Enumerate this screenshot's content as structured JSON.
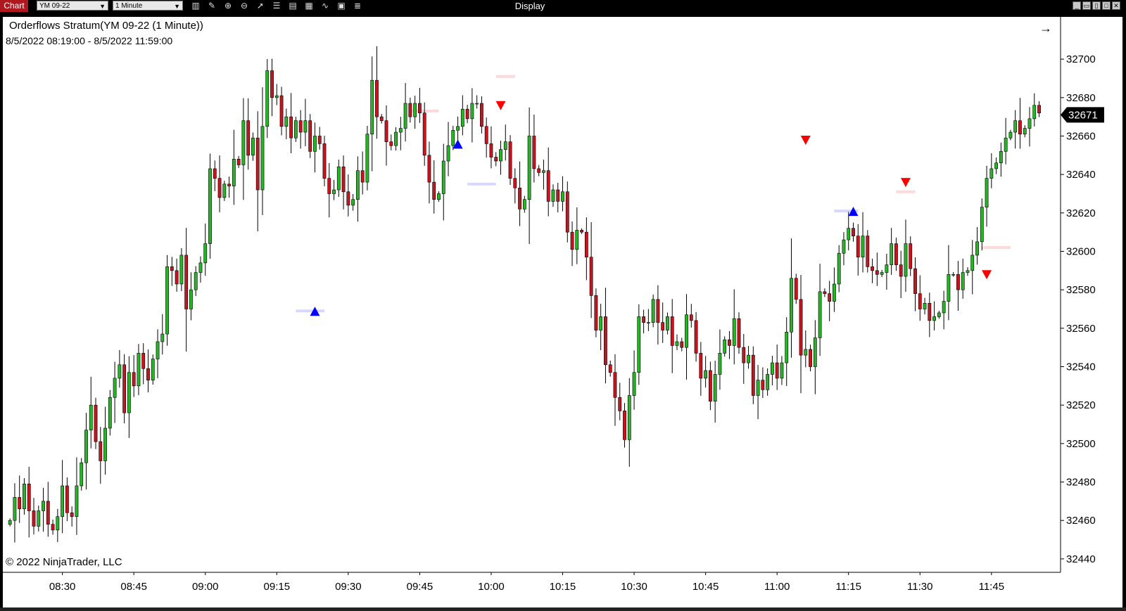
{
  "toolbar": {
    "app_label": "Chart",
    "instrument": "YM 09-22",
    "period": "1 Minute",
    "window_title": "Display",
    "tools": [
      "bar-style-icon",
      "pencil-icon",
      "zoom-in-icon",
      "zoom-out-icon",
      "pointer-icon",
      "properties-icon",
      "data-box-icon",
      "indicators-icon",
      "strategies-icon",
      "templates-icon",
      "menu-icon"
    ]
  },
  "chart": {
    "indicator_title": "Orderflows Stratum(YM 09-22 (1 Minute))",
    "date_range": "8/5/2022 08:19:00 - 8/5/2022 11:59:00",
    "copyright": "© 2022 NinjaTrader, LLC",
    "last_price": "32671",
    "colors": {
      "up": "#27b427",
      "down": "#c8141e",
      "signal_up": "#0000ff",
      "signal_down": "#ff0000",
      "price_marker": "#000000"
    }
  },
  "chart_data": {
    "type": "candlestick",
    "y_ticks": [
      32440,
      32460,
      32480,
      32500,
      32520,
      32540,
      32560,
      32580,
      32600,
      32620,
      32640,
      32660,
      32680,
      32700
    ],
    "x_ticks": [
      {
        "label": "08:30",
        "minute": 11
      },
      {
        "label": "08:45",
        "minute": 26
      },
      {
        "label": "09:00",
        "minute": 41
      },
      {
        "label": "09:15",
        "minute": 56
      },
      {
        "label": "09:30",
        "minute": 71
      },
      {
        "label": "09:45",
        "minute": 86
      },
      {
        "label": "10:00",
        "minute": 101
      },
      {
        "label": "10:15",
        "minute": 116
      },
      {
        "label": "10:30",
        "minute": 131
      },
      {
        "label": "10:45",
        "minute": 146
      },
      {
        "label": "11:00",
        "minute": 161
      },
      {
        "label": "11:15",
        "minute": 176
      },
      {
        "label": "11:30",
        "minute": 191
      },
      {
        "label": "11:45",
        "minute": 206
      }
    ],
    "ylim": [
      32433,
      32722
    ],
    "x_range": [
      -1.5,
      220.5
    ],
    "closes": [
      32460,
      32472,
      32466,
      32479,
      32465,
      32457,
      32465,
      32470,
      32458,
      32455,
      32462,
      32478,
      32464,
      32462,
      32478,
      32490,
      32507,
      32520,
      32501,
      32491,
      32508,
      32524,
      32534,
      32541,
      32516,
      32537,
      32530,
      32547,
      32539,
      32533,
      32544,
      32553,
      32557,
      32592,
      32590,
      32583,
      32598,
      32570,
      32580,
      32589,
      32594,
      32604,
      32643,
      32638,
      32628,
      32635,
      32634,
      32648,
      32645,
      32668,
      32650,
      32659,
      32632,
      32665,
      32694,
      32680,
      32681,
      32665,
      32670,
      32659,
      32668,
      32662,
      32668,
      32652,
      32660,
      32656,
      32638,
      32630,
      32632,
      32644,
      32631,
      32624,
      32627,
      32642,
      32636,
      32661,
      32689,
      32670,
      32668,
      32657,
      32655,
      32662,
      32664,
      32677,
      32670,
      32677,
      32672,
      32650,
      32636,
      32627,
      32630,
      32647,
      32655,
      32663,
      32665,
      32674,
      32669,
      32677,
      32677,
      32665,
      32656,
      32649,
      32647,
      32653,
      32657,
      32638,
      32633,
      32622,
      32627,
      32660,
      32643,
      32641,
      32642,
      32626,
      32632,
      32626,
      32631,
      32610,
      32601,
      32611,
      32610,
      32597,
      32577,
      32559,
      32566,
      32541,
      32537,
      32524,
      32517,
      32502,
      32525,
      32537,
      32566,
      32563,
      32563,
      32575,
      32563,
      32559,
      32566,
      32551,
      32553,
      32550,
      32567,
      32564,
      32547,
      32534,
      32538,
      32522,
      32536,
      32547,
      32554,
      32551,
      32565,
      32550,
      32542,
      32546,
      32525,
      32533,
      32528,
      32536,
      32542,
      32534,
      32542,
      32558,
      32586,
      32575,
      32546,
      32549,
      32540,
      32555,
      32579,
      32578,
      32574,
      32583,
      32599,
      32606,
      32612,
      32608,
      32597,
      32608,
      32592,
      32590,
      32588,
      32589,
      32593,
      32604,
      32593,
      32587,
      32604,
      32591,
      32578,
      32570,
      32573,
      32564,
      32566,
      32568,
      32574,
      32588,
      32588,
      32580,
      32589,
      32590,
      32598,
      32605,
      32623,
      32638,
      32643,
      32646,
      32652,
      32659,
      32662,
      32668,
      32661,
      32664,
      32669,
      32676,
      32672
    ],
    "signals": [
      {
        "bar": 64,
        "direction": "up",
        "price": 32569
      },
      {
        "bar": 94,
        "direction": "up",
        "price": 32656
      },
      {
        "bar": 103,
        "direction": "down",
        "price": 32676
      },
      {
        "bar": 177,
        "direction": "up",
        "price": 32621
      },
      {
        "bar": 167,
        "direction": "down",
        "price": 32658
      },
      {
        "bar": 188,
        "direction": "down",
        "price": 32636
      },
      {
        "bar": 205,
        "direction": "down",
        "price": 32588
      }
    ],
    "zones": [
      {
        "from_bar": 102,
        "to_bar": 106,
        "price": 32691,
        "direction": "down"
      },
      {
        "from_bar": 96,
        "to_bar": 102,
        "price": 32635,
        "direction": "up"
      },
      {
        "from_bar": 84,
        "to_bar": 90,
        "price": 32673,
        "direction": "down"
      },
      {
        "from_bar": 60,
        "to_bar": 66,
        "price": 32569,
        "direction": "up"
      },
      {
        "from_bar": 173,
        "to_bar": 178,
        "price": 32621,
        "direction": "up"
      },
      {
        "from_bar": 186,
        "to_bar": 190,
        "price": 32631,
        "direction": "down"
      },
      {
        "from_bar": 204,
        "to_bar": 210,
        "price": 32602,
        "direction": "down"
      }
    ]
  }
}
